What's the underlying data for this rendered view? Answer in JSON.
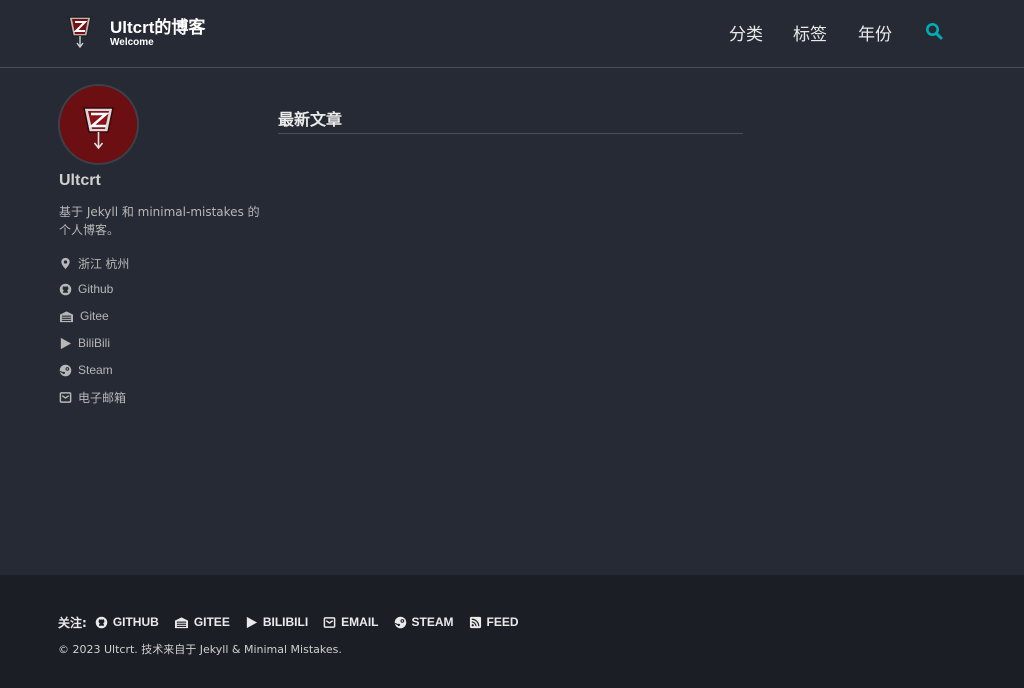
{
  "masthead": {
    "title": "Ultcrt的博客",
    "subtitle": "Welcome",
    "nav": [
      {
        "label": "分类"
      },
      {
        "label": "标签"
      },
      {
        "label": "年份"
      }
    ],
    "search_icon": "search-icon",
    "accent": "#00adb5"
  },
  "author": {
    "name": "Ultcrt",
    "bio": "基于 Jekyll 和 minimal-mistakes 的个人博客。",
    "links": [
      {
        "label": "浙江 杭州",
        "icon": "location-icon"
      },
      {
        "label": "Github",
        "icon": "github-icon"
      },
      {
        "label": "Gitee",
        "icon": "gitee-icon"
      },
      {
        "label": "BiliBili",
        "icon": "play-icon"
      },
      {
        "label": "Steam",
        "icon": "steam-icon"
      },
      {
        "label": "电子邮箱",
        "icon": "email-icon"
      }
    ]
  },
  "main": {
    "title": "最新文章"
  },
  "footer": {
    "follow_label": "关注:",
    "links": [
      {
        "label": "GITHUB",
        "icon": "github-icon"
      },
      {
        "label": "GITEE",
        "icon": "gitee-icon"
      },
      {
        "label": "BILIBILI",
        "icon": "play-icon"
      },
      {
        "label": "EMAIL",
        "icon": "email-icon"
      },
      {
        "label": "STEAM",
        "icon": "steam-icon"
      },
      {
        "label": "FEED",
        "icon": "rss-icon"
      }
    ],
    "copyright": "© 2023 Ultcrt. 技术来自于 Jekyll & Minimal Mistakes."
  }
}
